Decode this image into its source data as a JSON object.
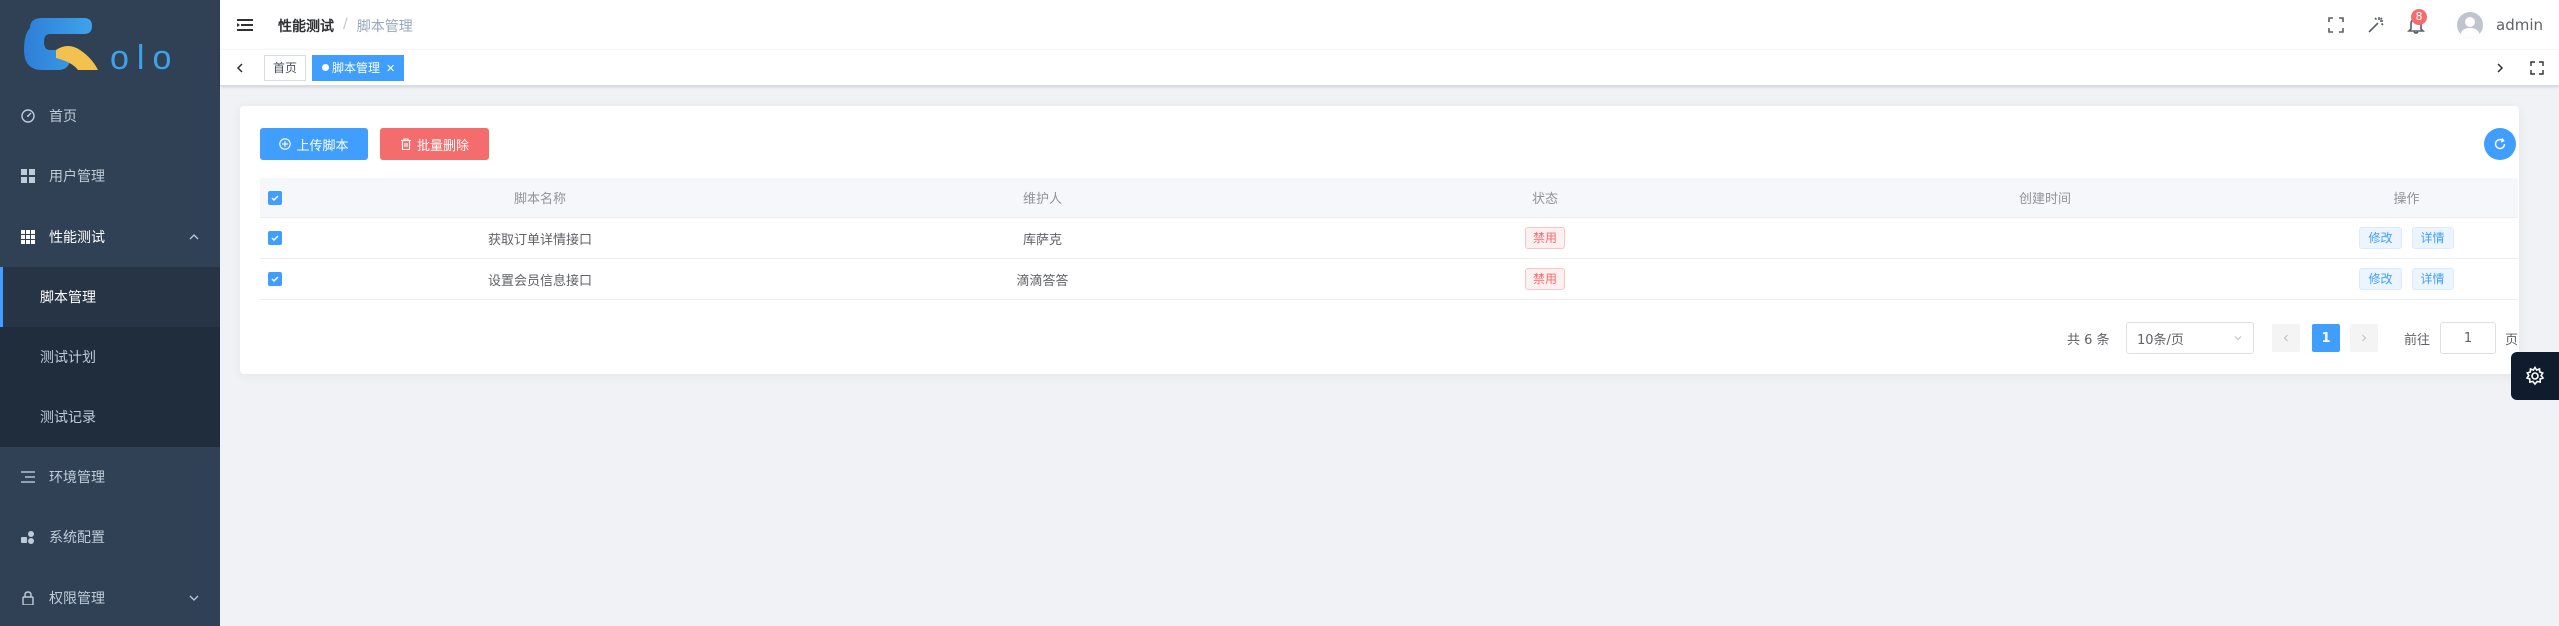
{
  "brand": {
    "logo_text": "olo"
  },
  "sidebar": {
    "items": [
      {
        "label": "首页",
        "icon": "dashboard-icon"
      },
      {
        "label": "用户管理",
        "icon": "users-icon"
      },
      {
        "label": "性能测试",
        "icon": "grid-icon",
        "expanded": true
      },
      {
        "label": "环境管理",
        "icon": "list-icon"
      },
      {
        "label": "系统配置",
        "icon": "component-icon"
      },
      {
        "label": "权限管理",
        "icon": "lock-icon"
      }
    ],
    "sub_items": [
      {
        "label": "脚本管理",
        "active": true
      },
      {
        "label": "测试计划"
      },
      {
        "label": "测试记录"
      }
    ]
  },
  "navbar": {
    "breadcrumb": [
      "性能测试",
      "脚本管理"
    ],
    "breadcrumb_separator": "/",
    "notification_count": "8",
    "user_name": "admin"
  },
  "tags": [
    {
      "label": "首页",
      "active": false
    },
    {
      "label": "脚本管理",
      "active": true
    }
  ],
  "toolbar": {
    "upload_label": "上传脚本",
    "batch_delete_label": "批量删除"
  },
  "table": {
    "columns": [
      "脚本名称",
      "维护人",
      "状态",
      "创建时间",
      "操作"
    ],
    "rows": [
      {
        "name": "获取订单详情接口",
        "maintainer": "库萨克",
        "status": "禁用",
        "created": "",
        "actions": [
          "修改",
          "详情"
        ]
      },
      {
        "name": "设置会员信息接口",
        "maintainer": "滴滴答答",
        "status": "禁用",
        "created": "",
        "actions": [
          "修改",
          "详情"
        ]
      }
    ]
  },
  "pagination": {
    "total_text": "共 6 条",
    "page_size": "10条/页",
    "current_page": "1",
    "goto_prefix": "前往",
    "goto_value": "1",
    "goto_suffix": "页"
  },
  "colors": {
    "sidebar_bg": "#304156",
    "primary": "#409eff",
    "danger": "#f56c6c"
  }
}
